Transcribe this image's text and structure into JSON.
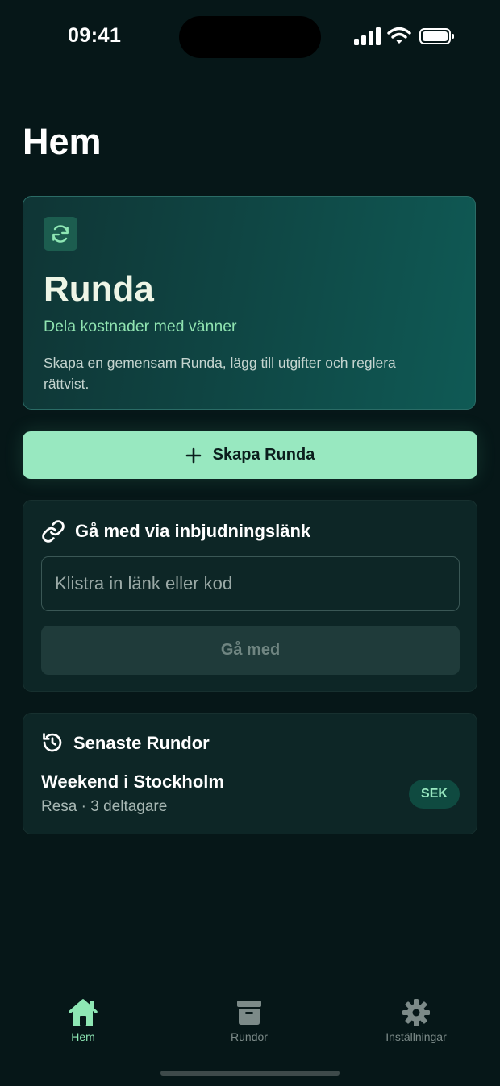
{
  "status_bar": {
    "time": "09:41"
  },
  "page": {
    "title": "Hem"
  },
  "hero": {
    "icon": "sync-icon",
    "title": "Runda",
    "subtitle": "Dela kostnader med vänner",
    "description": "Skapa en gemensam Runda, lägg till utgifter och reglera rättvist."
  },
  "create_button": {
    "icon": "plus-icon",
    "label": "Skapa Runda"
  },
  "join": {
    "icon": "link-icon",
    "heading": "Gå med via inbjudningslänk",
    "input_placeholder": "Klistra in länk eller kod",
    "input_value": "",
    "button_label": "Gå med"
  },
  "recent": {
    "icon": "history-icon",
    "heading": "Senaste Rundor",
    "items": [
      {
        "name": "Weekend i Stockholm",
        "meta": "Resa · 3 deltagare",
        "currency": "SEK"
      }
    ]
  },
  "tab_bar": {
    "tabs": [
      {
        "icon": "home-icon",
        "label": "Hem",
        "active": true
      },
      {
        "icon": "archive-icon",
        "label": "Rundor",
        "active": false
      },
      {
        "icon": "gear-icon",
        "label": "Inställningar",
        "active": false
      }
    ]
  },
  "colors": {
    "background": "#061718",
    "accent": "#98e8c0",
    "card": "#0d2626",
    "tab_active": "#8ee7b4",
    "tab_inactive": "#7c8a88"
  }
}
